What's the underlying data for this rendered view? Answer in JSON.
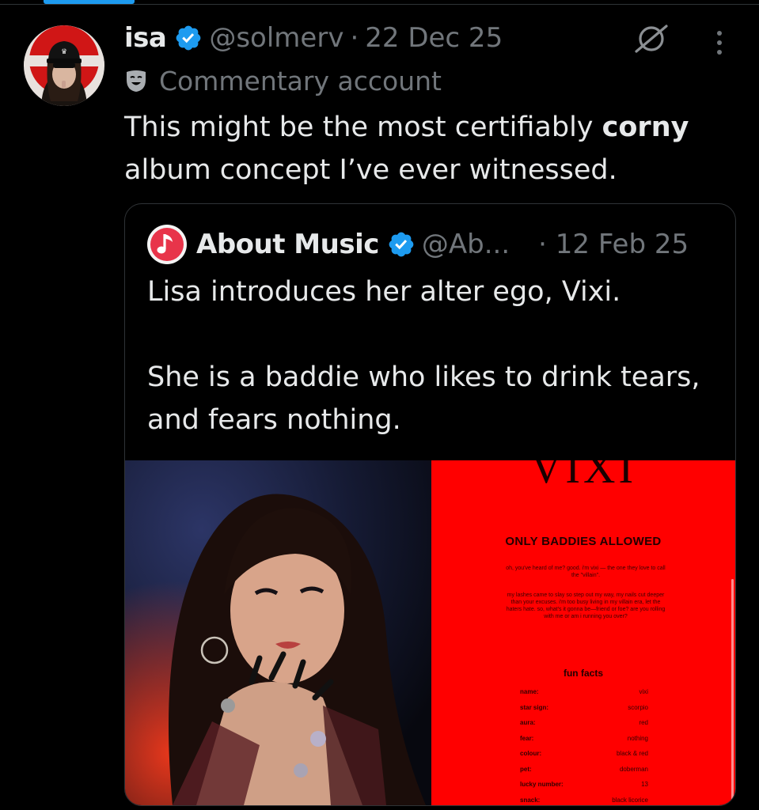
{
  "tweet": {
    "author_name": "isa",
    "handle": "@solmerv",
    "separator": "·",
    "date": "22 Dec 25",
    "label": "Commentary account",
    "text_before": "This might be the most certifiably ",
    "text_bold": "corny",
    "text_after": " album concept I’ve ever witnessed."
  },
  "quote": {
    "author_name": "About Music",
    "handle": "@Ab...",
    "date": "· 12 Feb 25",
    "paragraph1": "Lisa introduces her alter ego, Vixi.",
    "paragraph2": "She is a baddie who likes to drink tears, and fears nothing."
  },
  "card": {
    "title": "VIXI",
    "heading": "ONLY BADDIES ALLOWED",
    "para1": "oh, you've heard of me? good. i'm vixi — the one they love to call the \"villain\".",
    "para2": "my lashes came to slay so step out my way, my nails cut deeper than your excuses. i'm too busy living in my villain era, let the haters hate. so, what's it gonna be—friend or foe? are you rolling with me or am i running you over?",
    "fun_facts_heading": "fun facts",
    "facts": [
      {
        "key": "name:",
        "value": "vixi"
      },
      {
        "key": "star sign:",
        "value": "scorpio"
      },
      {
        "key": "aura:",
        "value": "red"
      },
      {
        "key": "fear:",
        "value": "nothing"
      },
      {
        "key": "colour:",
        "value": "black & red"
      },
      {
        "key": "pet:",
        "value": "doberman"
      },
      {
        "key": "lucky number:",
        "value": "13"
      },
      {
        "key": "snack:",
        "value": "black licorice"
      }
    ]
  },
  "colors": {
    "background": "#000000",
    "text_primary": "#e7e9ea",
    "text_secondary": "#71767b",
    "verified_blue": "#1d9bf0",
    "card_red": "#ff0000",
    "border": "#2f3336"
  },
  "icons": {
    "verified": "verified-badge-icon",
    "label": "theater-mask-icon",
    "grok": "grok-icon",
    "more": "more-vertical-icon",
    "music": "music-note-icon"
  }
}
